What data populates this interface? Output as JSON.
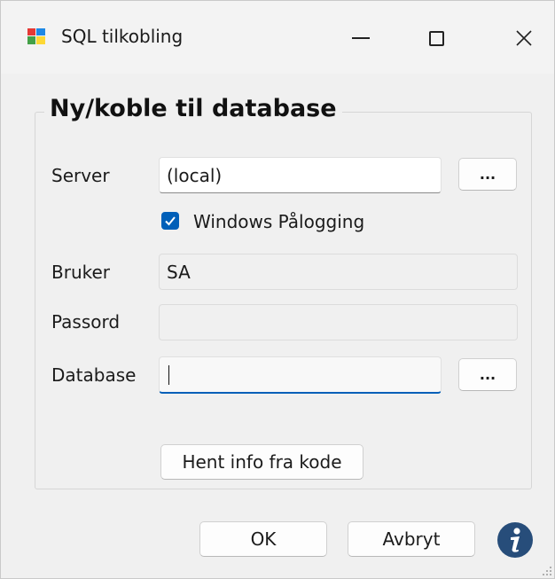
{
  "window": {
    "title": "SQL tilkobling",
    "icons": {
      "app": "app-icon",
      "minimize": "minimize-icon",
      "maximize": "maximize-icon",
      "close": "close-icon"
    }
  },
  "group": {
    "title": "Ny/koble til database"
  },
  "form": {
    "server_label": "Server",
    "server_value": "(local)",
    "server_browse_label": "...",
    "windows_login_label": "Windows Pålogging",
    "windows_login_checked": true,
    "user_label": "Bruker",
    "user_value": "SA",
    "password_label": "Passord",
    "password_value": "",
    "database_label": "Database",
    "database_value": "",
    "database_browse_label": "...",
    "fetch_info_label": "Hent info fra kode"
  },
  "footer": {
    "ok_label": "OK",
    "cancel_label": "Avbryt",
    "info_icon": "info-icon"
  },
  "colors": {
    "accent": "#005fb8",
    "window_bg": "#f0f0f0"
  }
}
